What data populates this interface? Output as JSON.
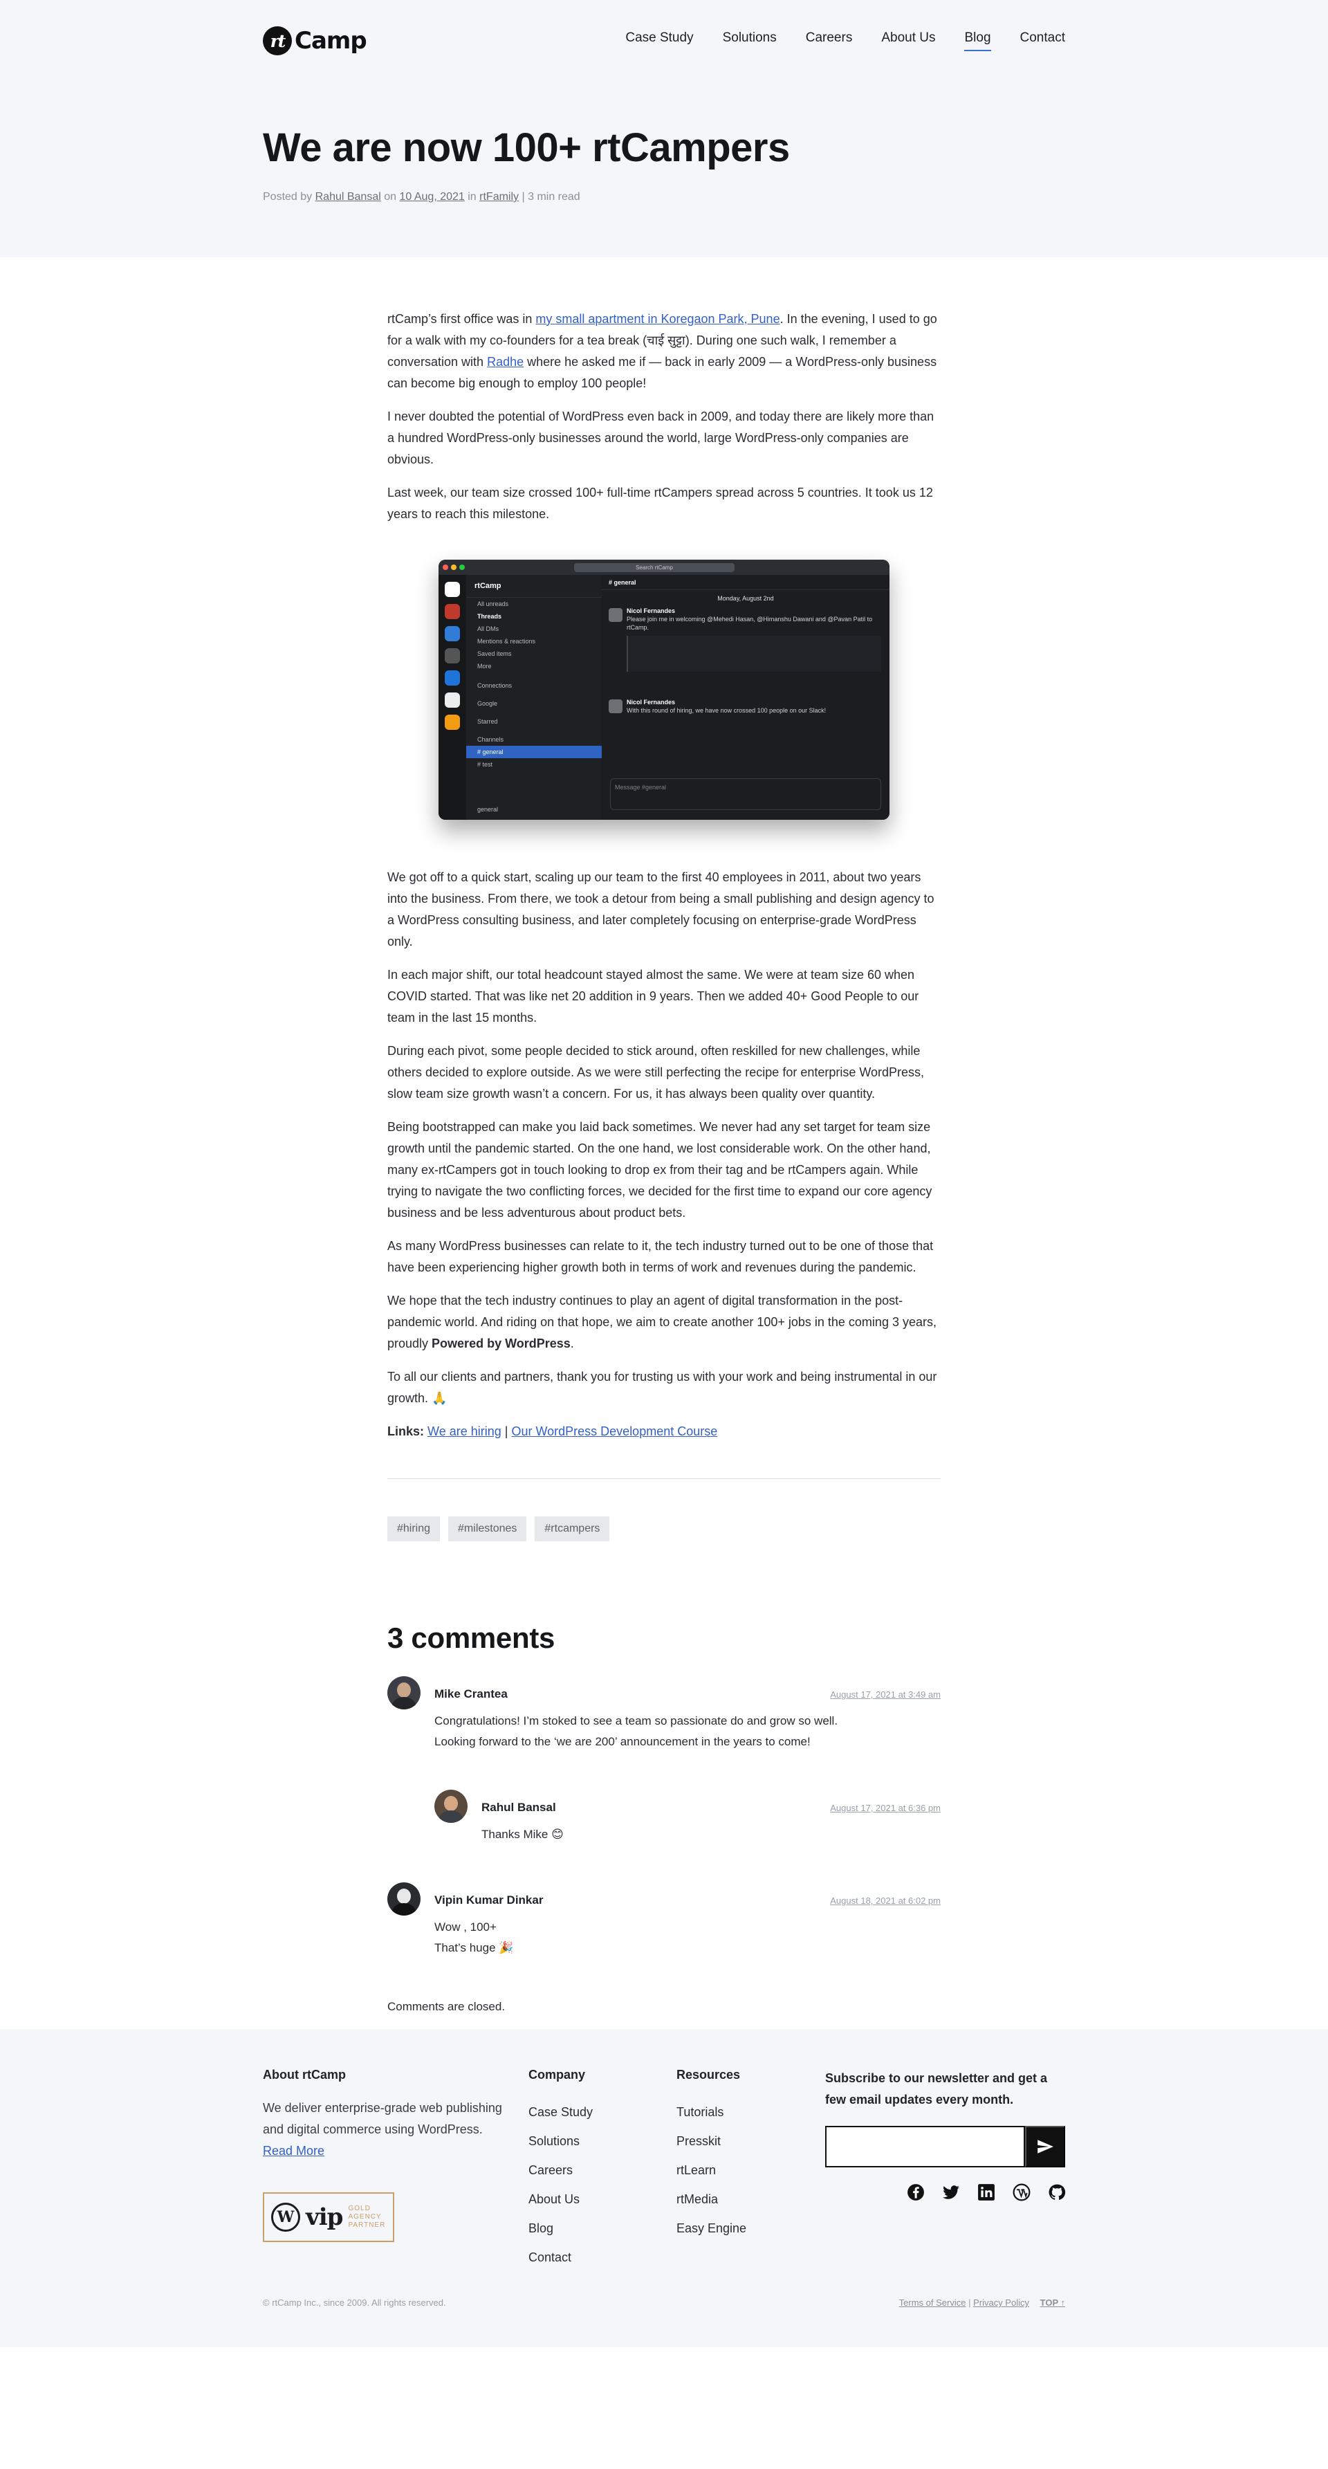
{
  "header": {
    "logo_mark": "rt",
    "logo_text": "Camp",
    "nav": [
      "Case Study",
      "Solutions",
      "Careers",
      "About Us",
      "Blog",
      "Contact"
    ],
    "active_nav": "Blog"
  },
  "post": {
    "title": "We are now 100+ rtCampers",
    "meta": {
      "posted_by_label": "Posted by",
      "author": "Rahul Bansal",
      "on_label": "on",
      "date": "10 Aug, 2021",
      "in_label": "in",
      "category": "rtFamily",
      "read_time": "| 3 min read"
    },
    "p1_a": "rtCamp’s first office was in ",
    "p1_link": "my small apartment in Koregaon Park, Pune",
    "p1_b": ". In the evening, I used to go for a walk with my co-founders for a tea break (चाई सुट्टा). During one such walk, I remember a conversation with ",
    "p1_link2": "Radhe",
    "p1_c": " where he asked me if — back in early 2009 — a WordPress-only business can become big enough to employ 100 people!",
    "p2": "I never doubted the potential of WordPress even back in 2009, and today there are likely more than a hundred WordPress-only businesses around the world, large WordPress-only companies are obvious.",
    "p3": "Last week, our team size crossed 100+ full-time rtCampers spread across 5 countries. It took us 12 years to reach this milestone.",
    "p4": "We got off to a quick start, scaling up our team to the first 40 employees in 2011, about two years into the business. From there, we took a detour from being a small publishing and design agency to a WordPress consulting business, and later completely focusing on enterprise-grade WordPress only.",
    "p5": "In each major shift, our total headcount stayed almost the same. We were at team size 60 when COVID started. That was like net 20 addition in 9 years. Then we added 40+ Good People to our team in the last 15 months.",
    "p6": "During each pivot, some people decided to stick around, often reskilled for new challenges, while others decided to explore outside. As we were still perfecting the recipe for enterprise WordPress, slow team size growth wasn’t a concern. For us, it has always been quality over quantity.",
    "p7": "Being bootstrapped can make you laid back sometimes. We never had any set target for team size growth until the pandemic started. On the one hand, we lost considerable work. On the other hand, many ex-rtCampers got in touch looking to drop ex from their tag and be rtCampers again. While trying to navigate the two conflicting forces, we decided for the first time to expand our core agency business and be less adventurous about product bets.",
    "p8": "As many WordPress businesses can relate to it, the tech industry turned out to be one of those that have been experiencing higher growth both in terms of work and revenues during the pandemic.",
    "p9_a": "We hope that the tech industry continues to play an agent of digital transformation in the post-pandemic world. And riding on that hope, we aim to create another 100+ jobs in the coming 3 years, proudly ",
    "p9_b": "Powered by WordPress",
    "p9_c": ".",
    "p10": "To all our clients and partners, thank you for trusting us with your work and being instrumental in our growth. 🙏",
    "links_label": "Links:",
    "link_a": "We are hiring",
    "link_sep": "|",
    "link_b": "Our WordPress Development Course",
    "tags": [
      "#hiring",
      "#milestones",
      "#rtcampers"
    ]
  },
  "screenshot": {
    "search": "Search rtCamp",
    "workspace": "rtCamp",
    "sidebar": [
      "All unreads",
      "Threads",
      "All DMs",
      "Mentions & reactions",
      "Saved items",
      "More",
      "Connections",
      "Google",
      "Starred",
      "Channels",
      "# general",
      "# test"
    ],
    "channel": "# general",
    "date_divider": "Monday, August 2nd",
    "msg1_name": "Nicol Fernandes",
    "msg1_text": "Please join me in welcoming @Mehedi Hasan, @Himanshu Dawani and @Pavan Patil to rtCamp.",
    "msg2_name": "Nicol Fernandes",
    "msg2_text": "With this round of hiring, we have now crossed 100 people on our Slack!",
    "composer": "Message #general",
    "footer_channel": "general"
  },
  "comments": {
    "title": "3 comments",
    "items": [
      {
        "name": "Mike Crantea",
        "date": "August 17, 2021 at 3:49 am",
        "line1": "Congratulations! I’m stoked to see a team so passionate do and grow so well.",
        "line2": "Looking forward to the ‘we are 200’ announcement in the years to come!"
      },
      {
        "name": "Rahul Bansal",
        "date": "August 17, 2021 at 6:36 pm",
        "line1": "Thanks Mike 😊",
        "line2": ""
      },
      {
        "name": "Vipin Kumar Dinkar",
        "date": "August 18, 2021 at 6:02 pm",
        "line1": "Wow , 100+",
        "line2": "That’s huge 🎉"
      }
    ],
    "closed": "Comments are closed."
  },
  "footer": {
    "about_title": "About rtCamp",
    "about_text": "We deliver enterprise-grade web publishing and digital commerce using WordPress. ",
    "read_more": "Read More",
    "company_title": "Company",
    "company_links": [
      "Case Study",
      "Solutions",
      "Careers",
      "About Us",
      "Blog",
      "Contact"
    ],
    "resources_title": "Resources",
    "resources_links": [
      "Tutorials",
      "Presskit",
      "rtLearn",
      "rtMedia",
      "Easy Engine"
    ],
    "newsletter_title": "Subscribe to our newsletter and get a few email updates every month.",
    "vip_w": "W",
    "vip_text": "vip",
    "vip_line1": "GOLD",
    "vip_line2": "AGENCY",
    "vip_line3": "PARTNER",
    "copyright": "© rtCamp Inc., since 2009. All rights reserved.",
    "terms": "Terms of Service",
    "privacy": "Privacy Policy",
    "top": "TOP ↑"
  }
}
